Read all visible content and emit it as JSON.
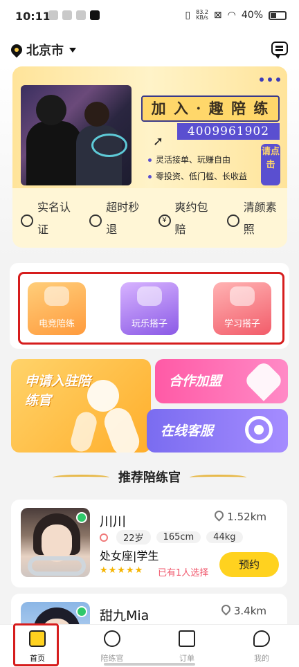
{
  "status_bar": {
    "time": "10:11",
    "net_speed_value": "83.2",
    "net_speed_unit": "KB/s",
    "battery": "40%"
  },
  "header": {
    "city": "北京市"
  },
  "banner": {
    "headline": "加 入 · 趣 陪 练",
    "phone": "4009961902",
    "features": [
      "灵活接单、玩赚自由",
      "零投资、低门槛、长收益"
    ],
    "click_badge": "请点击"
  },
  "guarantees": [
    {
      "label": "实名认证",
      "icon": "verified-user-icon"
    },
    {
      "label": "超时秒退",
      "icon": "clock-refund-icon"
    },
    {
      "label": "爽约包赔",
      "icon": "yen-compensation-icon"
    },
    {
      "label": "清颜素照",
      "icon": "portrait-photo-icon"
    }
  ],
  "categories": [
    {
      "label": "电竞陪练",
      "icon": "gamepad-icon",
      "color": "#ff9b3d"
    },
    {
      "label": "玩乐搭子",
      "icon": "mouse-icon",
      "color": "#8b5ae6"
    },
    {
      "label": "学习搭子",
      "icon": "book-heart-icon",
      "color": "#f25c6a"
    }
  ],
  "promos": {
    "apply": "申请入驻陪练官",
    "join": "合作加盟",
    "service": "在线客服"
  },
  "section_title": "推荐陪练官",
  "companions": [
    {
      "name": "川川",
      "distance": "1.52km",
      "age": "22岁",
      "height": "165cm",
      "weight": "44kg",
      "zodiac": "处女座|学生",
      "rating_stars": 5,
      "booked_text": "已有1人选择",
      "book_label": "预约",
      "online": true
    },
    {
      "name": "甜九Mia",
      "distance": "3.4km",
      "online": true
    }
  ],
  "bottom_nav": [
    {
      "label": "首页",
      "icon": "home-icon",
      "active": true
    },
    {
      "label": "陪练官",
      "icon": "companion-icon",
      "active": false
    },
    {
      "label": "订单",
      "icon": "order-icon",
      "active": false
    },
    {
      "label": "我的",
      "icon": "profile-icon",
      "active": false
    }
  ],
  "colors": {
    "accent": "#ffd21f",
    "highlight_box": "#d61d1d",
    "online": "#2fc86a"
  }
}
